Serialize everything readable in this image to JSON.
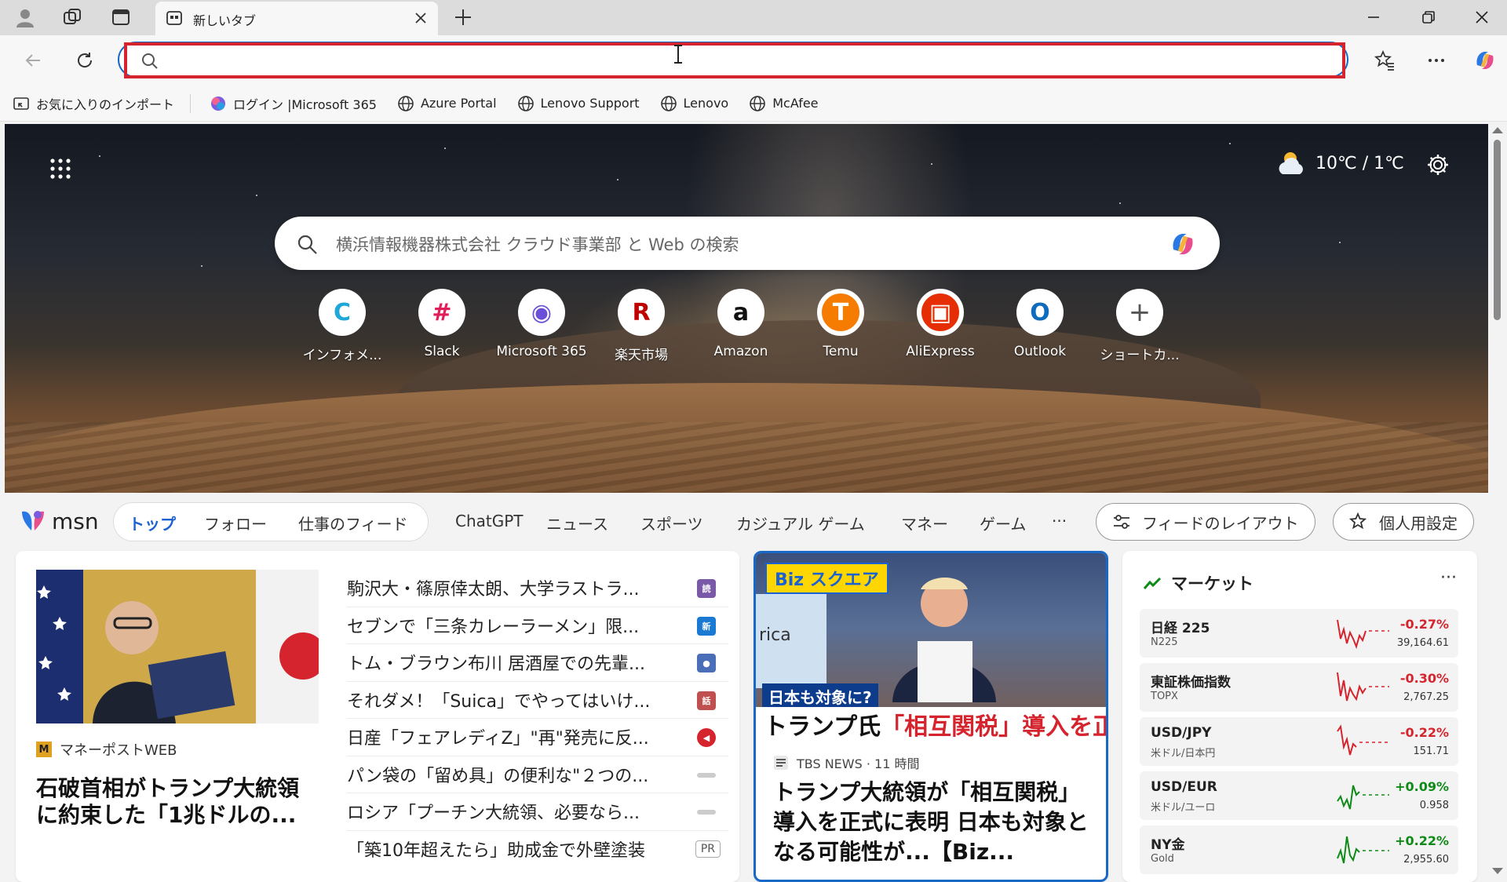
{
  "tab": {
    "title": "新しいタブ"
  },
  "address": {
    "value": "",
    "placeholder": ""
  },
  "favorites": [
    {
      "label": "お気に入りのインポート",
      "icon": "import-favorites-icon"
    },
    {
      "label": "ログイン |Microsoft 365",
      "icon": "microsoft365-icon"
    },
    {
      "label": "Azure Portal",
      "icon": "globe-icon"
    },
    {
      "label": "Lenovo Support",
      "icon": "globe-icon"
    },
    {
      "label": "Lenovo",
      "icon": "globe-icon"
    },
    {
      "label": "McAfee",
      "icon": "globe-icon"
    }
  ],
  "weather": {
    "temp": "10℃ / 1℃",
    "icon": "partly-cloudy-icon"
  },
  "search": {
    "placeholder": "横浜情報機器株式会社 クラウド事業部 と Web の検索"
  },
  "shortcuts": [
    {
      "label": "インフォメ...",
      "glyph": "C",
      "color": "#1fa7d9"
    },
    {
      "label": "Slack",
      "glyph": "#",
      "color": "#e01e5a"
    },
    {
      "label": "Microsoft 365",
      "glyph": "◉",
      "color": "#6b4fd8"
    },
    {
      "label": "楽天市場",
      "glyph": "R",
      "color": "#bf0000"
    },
    {
      "label": "Amazon",
      "glyph": "a",
      "color": "#111111"
    },
    {
      "label": "Temu",
      "glyph": "T",
      "color": "#f57c00"
    },
    {
      "label": "AliExpress",
      "glyph": "▣",
      "color": "#e62e04"
    },
    {
      "label": "Outlook",
      "glyph": "O",
      "color": "#0f6cbd"
    },
    {
      "label": "ショートカ...",
      "glyph": "+",
      "color": "#555555"
    }
  ],
  "msn": {
    "logo": "msn",
    "nav": [
      "トップ",
      "フォロー",
      "仕事のフィード",
      "ChatGPT",
      "ニュース",
      "スポーツ",
      "カジュアル ゲーム",
      "マネー",
      "ゲーム",
      "···"
    ],
    "layout_button": "フィードのレイアウト",
    "personalize_button": "個人用設定"
  },
  "featured": {
    "source": "マネーポストWEB",
    "title": "石破首相がトランプ大統領に約束した「1兆ドルの..."
  },
  "headlines": [
    {
      "text": "駒沢大・篠原倖太朗、大学ラストラ...",
      "color": "#7a5aa8",
      "badge": "読"
    },
    {
      "text": "セブンで「三条カレーラーメン」限...",
      "color": "#1a7ad3",
      "badge": "新"
    },
    {
      "text": "トム・ブラウン布川 居酒屋での先輩...",
      "color": "#4a6fb8",
      "badge": "●"
    },
    {
      "text": "それダメ！「Suica」でやってはいけ...",
      "color": "#c05050",
      "badge": "話"
    },
    {
      "text": "日産「フェアレディZ」\"再\"発売に反...",
      "color": "#d5242d",
      "badge": "◀"
    },
    {
      "text": "パン袋の「留め具」の便利な\"２つの...",
      "color": "#cccccc",
      "badge": ""
    },
    {
      "text": "ロシア「プーチン大統領、必要なら...",
      "color": "#cccccc",
      "badge": ""
    },
    {
      "text": "「築10年超えたら」助成金で外壁塗装",
      "color": "",
      "badge": "PR"
    }
  ],
  "news": {
    "tag": "Biz スクエア",
    "map_text": "rica",
    "caption1": "日本も対象に?",
    "caption2_a": "トランプ氏",
    "caption2_b": "「相互関税」導入を正式表明",
    "source": "TBS NEWS · 11 時間",
    "title": "トランプ大統領が「相互関税」導入を正式に表明 日本も対象となる可能性が...【Biz..."
  },
  "market": {
    "title": "マーケット",
    "more": "···",
    "rows": [
      {
        "name": "日経 225",
        "sub": "N225",
        "change": "-0.27%",
        "value": "39,164.61",
        "trend": "down"
      },
      {
        "name": "東証株価指数",
        "sub": "TOPX",
        "change": "-0.30%",
        "value": "2,767.25",
        "trend": "down"
      },
      {
        "name": "USD/JPY",
        "sub": "米ドル/日本円",
        "change": "-0.22%",
        "value": "151.71",
        "trend": "down"
      },
      {
        "name": "USD/EUR",
        "sub": "米ドル/ユーロ",
        "change": "+0.09%",
        "value": "0.958",
        "trend": "up"
      },
      {
        "name": "NY金",
        "sub": "Gold",
        "change": "+0.22%",
        "value": "2,955.60",
        "trend": "up"
      }
    ]
  },
  "colors": {
    "accent": "#1868c8",
    "highlight": "#d5242d",
    "negative": "#d5242d",
    "positive": "#0e8a16"
  }
}
